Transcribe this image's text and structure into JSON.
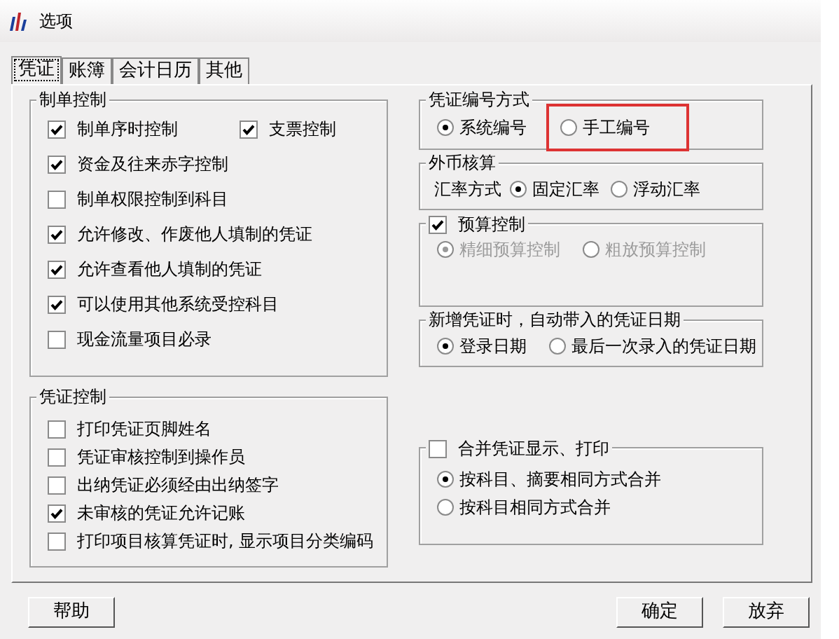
{
  "window": {
    "title": "选项"
  },
  "tabs": [
    {
      "label": "凭证",
      "selected": true
    },
    {
      "label": "账簿",
      "selected": false
    },
    {
      "label": "会计日历",
      "selected": false
    },
    {
      "label": "其他",
      "selected": false
    }
  ],
  "left_groups": [
    {
      "title": "制单控制",
      "rows": [
        [
          {
            "kind": "checkbox",
            "label": "制单序时控制",
            "checked": true
          },
          {
            "kind": "checkbox",
            "label": "支票控制",
            "checked": true
          }
        ],
        [
          {
            "kind": "checkbox",
            "label": "资金及往来赤字控制",
            "checked": true
          }
        ],
        [
          {
            "kind": "checkbox",
            "label": "制单权限控制到科目",
            "checked": false
          }
        ],
        [
          {
            "kind": "checkbox",
            "label": "允许修改、作废他人填制的凭证",
            "checked": true
          }
        ],
        [
          {
            "kind": "checkbox",
            "label": "允许查看他人填制的凭证",
            "checked": true
          }
        ],
        [
          {
            "kind": "checkbox",
            "label": "可以使用其他系统受控科目",
            "checked": true
          }
        ],
        [
          {
            "kind": "checkbox",
            "label": "现金流量项目必录",
            "checked": false
          }
        ]
      ]
    },
    {
      "title": "凭证控制",
      "rows": [
        [
          {
            "kind": "checkbox",
            "label": "打印凭证页脚姓名",
            "checked": false
          }
        ],
        [
          {
            "kind": "checkbox",
            "label": "凭证审核控制到操作员",
            "checked": false
          }
        ],
        [
          {
            "kind": "checkbox",
            "label": "出纳凭证必须经由出纳签字",
            "checked": false
          }
        ],
        [
          {
            "kind": "checkbox",
            "label": "未审核的凭证允许记账",
            "checked": true
          }
        ],
        [
          {
            "kind": "checkbox",
            "label": "打印项目核算凭证时, 显示项目分类编码",
            "checked": false
          }
        ]
      ]
    }
  ],
  "right_groups": [
    {
      "title": "凭证编号方式",
      "rows": [
        [
          {
            "kind": "radio",
            "label": "系统编号",
            "selected": true,
            "highlighted": false
          },
          {
            "kind": "radio",
            "label": "手工编号",
            "selected": false,
            "highlighted": true
          }
        ]
      ]
    },
    {
      "title": "外币核算",
      "rows": [
        [
          {
            "kind": "label",
            "label": "汇率方式"
          },
          {
            "kind": "radio",
            "label": "固定汇率",
            "selected": true
          },
          {
            "kind": "radio",
            "label": "浮动汇率",
            "selected": false
          }
        ]
      ]
    },
    {
      "title_checkbox": {
        "label": "预算控制",
        "checked": true
      },
      "rows": [
        [
          {
            "kind": "radio",
            "label": "精细预算控制",
            "selected": true,
            "disabled": true
          },
          {
            "kind": "radio",
            "label": "粗放预算控制",
            "selected": false,
            "disabled": true
          }
        ]
      ]
    },
    {
      "title": "新增凭证时，自动带入的凭证日期",
      "rows": [
        [
          {
            "kind": "radio",
            "label": "登录日期",
            "selected": true
          },
          {
            "kind": "radio",
            "label": "最后一次录入的凭证日期",
            "selected": false
          }
        ]
      ]
    },
    {
      "title_checkbox": {
        "label": "合并凭证显示、打印",
        "checked": false
      },
      "rows": [
        [
          {
            "kind": "radio",
            "label": "按科目、摘要相同方式合并",
            "selected": true
          }
        ],
        [
          {
            "kind": "radio",
            "label": "按科目相同方式合并",
            "selected": false
          }
        ]
      ]
    }
  ],
  "buttons": [
    {
      "label": "帮助"
    },
    {
      "label": "确定"
    },
    {
      "label": "放弃"
    }
  ]
}
